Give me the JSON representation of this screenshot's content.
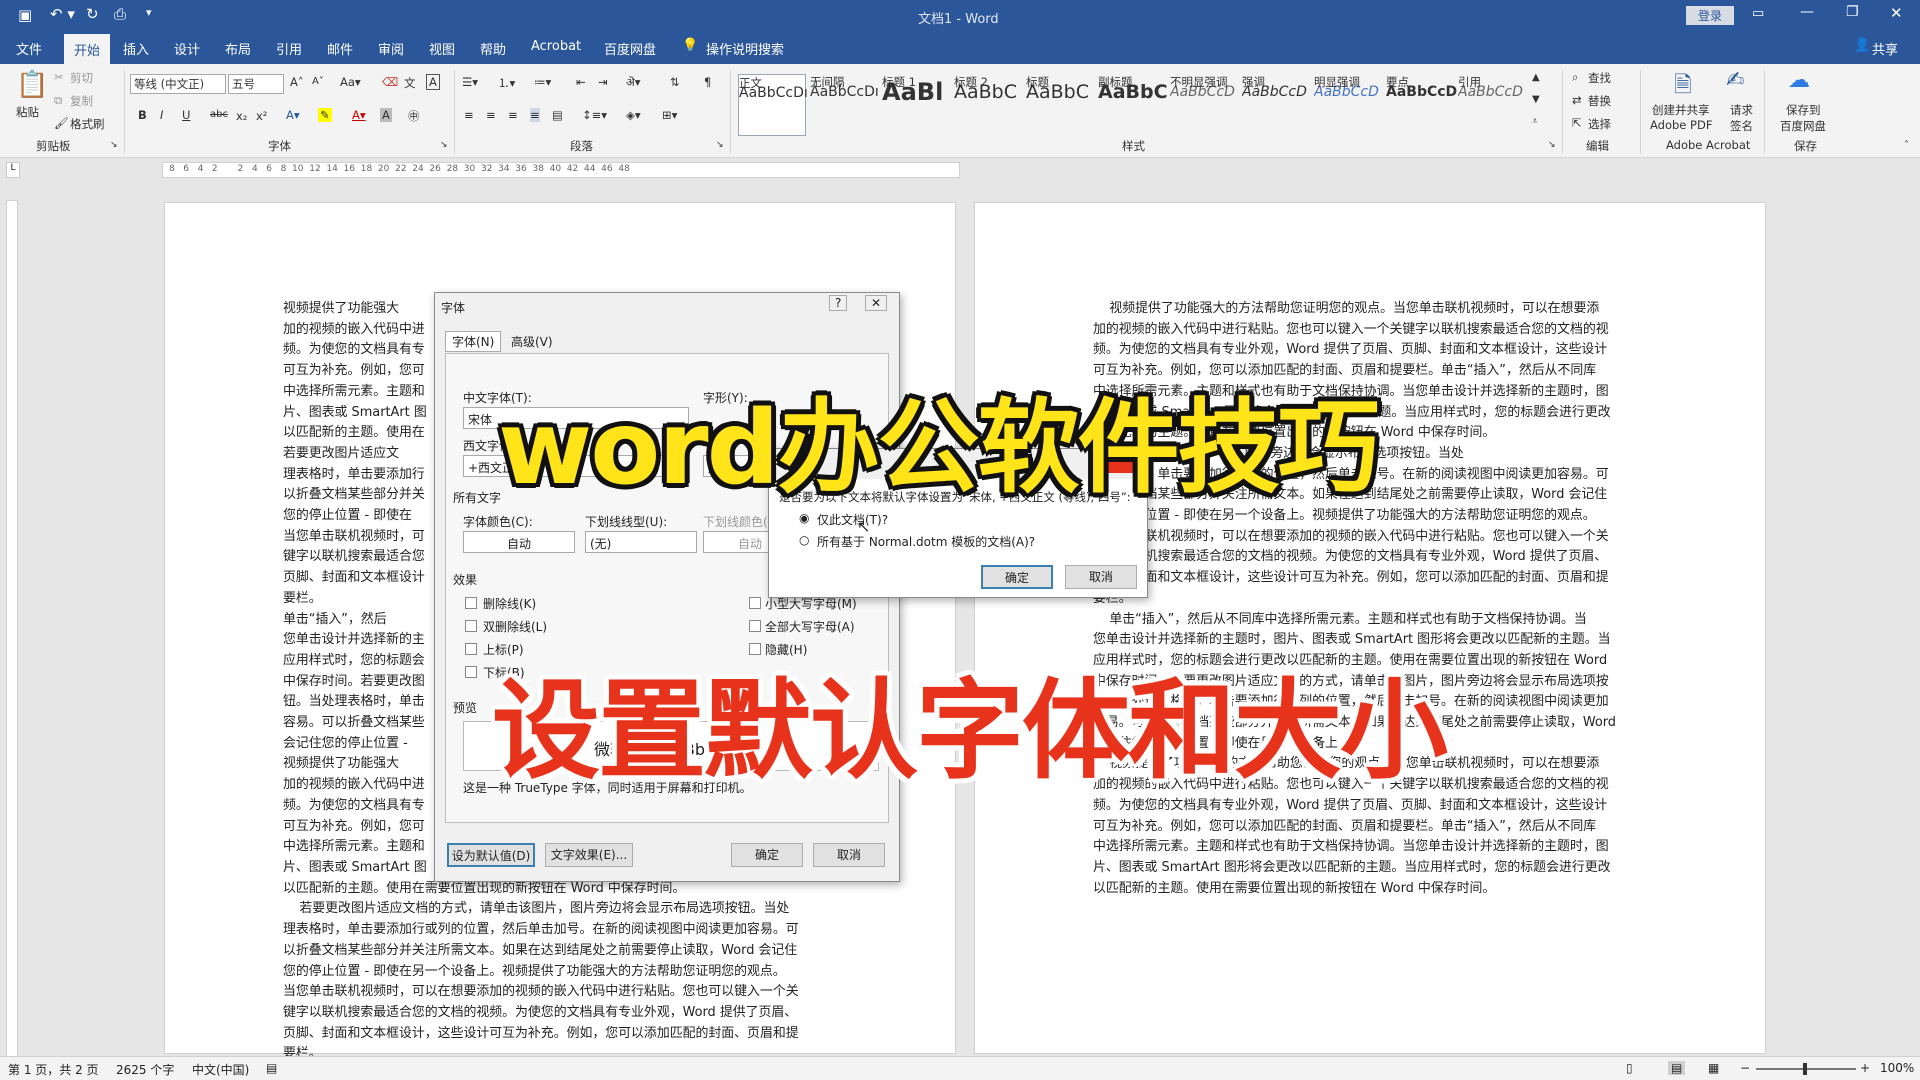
{
  "title": {
    "doc": "文档1",
    "sep": "-",
    "app": "Word",
    "login": "登录"
  },
  "tabs": [
    "文件",
    "开始",
    "插入",
    "设计",
    "布局",
    "引用",
    "邮件",
    "审阅",
    "视图",
    "帮助",
    "Acrobat",
    "百度网盘",
    "操作说明搜索"
  ],
  "share": "共享",
  "clipboard": {
    "paste": "粘贴",
    "cut": "剪切",
    "copy": "复制",
    "painter": "格式刷",
    "group": "剪贴板"
  },
  "font": {
    "name": "等线 (中文正)",
    "size": "五号",
    "group": "字体",
    "bold": "B",
    "italic": "I",
    "underline": "U"
  },
  "paragraph": {
    "group": "段落"
  },
  "styles": {
    "group": "样式",
    "items": [
      {
        "sample": "AaBbCcDı",
        "name": "正文"
      },
      {
        "sample": "AaBbCcDı",
        "name": "无间隔"
      },
      {
        "sample": "AaBl",
        "name": "标题 1"
      },
      {
        "sample": "AaBbC",
        "name": "标题 2"
      },
      {
        "sample": "AaBbC",
        "name": "标题"
      },
      {
        "sample": "AaBbC",
        "name": "副标题"
      },
      {
        "sample": "AaBbCcD",
        "name": "不明显强调"
      },
      {
        "sample": "AaBbCcD",
        "name": "强调"
      },
      {
        "sample": "AaBbCcD",
        "name": "明显强调"
      },
      {
        "sample": "AaBbCcD",
        "name": "要点"
      },
      {
        "sample": "AaBbCcD",
        "name": "引用"
      }
    ]
  },
  "editing": {
    "find": "查找",
    "replace": "替换",
    "select": "选择",
    "group": "编辑"
  },
  "acrobat": {
    "create1": "创建并共享",
    "create2": "Adobe PDF",
    "request1": "请求",
    "request2": "签名",
    "group": "Adobe Acrobat"
  },
  "save": {
    "l1": "保存到",
    "l2": "百度网盘",
    "group": "保存"
  },
  "ruler_numbers": "8   6   4   2       2   4   6   8  10  12  14  16  18  20  22  24  26  28  30  32  34  36  38  40  42  44  46  48",
  "page1_lines": [
    "视频提供了功能强大",
    "加的视频的嵌入代码中进",
    "频。为使您的文档具有专",
    "可互为补充。例如，您可",
    "中选择所需元素。主题和",
    "片、图表或 SmartArt 图",
    "以匹配新的主题。使用在",
    "若要更改图片适应文",
    "理表格时，单击要添加行",
    "以折叠文档某些部分并关",
    "您的停止位置 - 即使在",
    "当您单击联机视频时，可",
    "键字以联机搜索最适合您",
    "页脚、封面和文本框设计",
    "要栏。",
    "单击“插入”，然后",
    "您单击设计并选择新的主",
    "应用样式时，您的标题会",
    "中保存时间。若要更改图",
    "钮。当处理表格时，单击",
    "容易。可以折叠文档某些",
    "会记住您的停止位置 -",
    "视频提供了功能强大",
    "加的视频的嵌入代码中进",
    "频。为使您的文档具有专",
    "可互为补充。例如，您可",
    "中选择所需元素。主题和",
    "片、图表或 SmartArt 图",
    "以匹配新的主题。使用在需要位置出现的新按钮在 Word 中保存时间。",
    "    若要更改图片适应文档的方式，请单击该图片，图片旁边将会显示布局选项按钮。当处",
    "理表格时，单击要添加行或列的位置，然后单击加号。在新的阅读视图中阅读更加容易。可",
    "以折叠文档某些部分并关注所需文本。如果在达到结尾处之前需要停止读取，Word 会记住",
    "您的停止位置 - 即使在另一个设备上。视频提供了功能强大的方法帮助您证明您的观点。",
    "当您单击联机视频时，可以在想要添加的视频的嵌入代码中进行粘贴。您也可以键入一个关",
    "键字以联机搜索最适合您的文档的视频。为使您的文档具有专业外观，Word 提供了页眉、",
    "页脚、封面和文本框设计，这些设计可互为补充。例如，您可以添加匹配的封面、页眉和提",
    "要栏。"
  ],
  "page2_lines": [
    "    视频提供了功能强大的方法帮助您证明您的观点。当您单击联机视频时，可以在想要添",
    "加的视频的嵌入代码中进行粘贴。您也可以键入一个关键字以联机搜索最适合您的文档的视",
    "频。为使您的文档具有专业外观，Word 提供了页眉、页脚、封面和文本框设计，这些设计",
    "可互为补充。例如，您可以添加匹配的封面、页眉和提要栏。单击“插入”，然后从不同库",
    "中选择所需元素。主题和样式也有助于文档保持协调。当您单击设计并选择新的主题时，图",
    "片、图表或 SmartArt 图形将会更改以匹配新的主题。当应用样式时，您的标题会进行更改",
    "以匹配新的主题。使用在需要位置出现的新按钮在 Word 中保存时间。",
    "                                     图片旁边将会显示布局选项按钮。当处",
    "理表格时，单击要添加行或列的位置，然后单击加号。在新的阅读视图中阅读更加容易。可",
    "以折叠文档某些部分并关注所需文本。如果在达到结尾处之前需要停止读取，Word 会记住",
    "您的停止位置 - 即使在另一个设备上。视频提供了功能强大的方法帮助您证明您的观点。",
    "当您单击联机视频时，可以在想要添加的视频的嵌入代码中进行粘贴。您也可以键入一个关",
    "键字以联机搜索最适合您的文档的视频。为使您的文档具有专业外观，Word 提供了页眉、",
    "页脚、封面和文本框设计，这些设计可互为补充。例如，您可以添加匹配的封面、页眉和提",
    "要栏。",
    "    单击“插入”，然后从不同库中选择所需元素。主题和样式也有助于文档保持协调。当",
    "您单击设计并选择新的主题时，图片、图表或 SmartArt 图形将会更改以匹配新的主题。当",
    "应用样式时，您的标题会进行更改以匹配新的主题。使用在需要位置出现的新按钮在 Word",
    "中保存时间。若要更改图片适应文档的方式，请单击该图片，图片旁边将会显示布局选项按",
    "钮。当处理表格时，单击要添加行或列的位置，然后单击加号。在新的阅读视图中阅读更加",
    "容易。可以折叠文档某些部分并关注所需文本。如果在达到结尾处之前需要停止读取，Word",
    "会记住您的停止位置 - 即使在另一个设备上。",
    "    视频提供了功能强大的方法帮助您证明您的观点。当您单击联机视频时，可以在想要添",
    "加的视频的嵌入代码中进行粘贴。您也可以键入一个关键字以联机搜索最适合您的文档的视",
    "频。为使您的文档具有专业外观，Word 提供了页眉、页脚、封面和文本框设计，这些设计",
    "可互为补充。例如，您可以添加匹配的封面、页眉和提要栏。单击“插入”，然后从不同库",
    "中选择所需元素。主题和样式也有助于文档保持协调。当您单击设计并选择新的主题时，图",
    "片、图表或 SmartArt 图形将会更改以匹配新的主题。当应用样式时，您的标题会进行更改",
    "以匹配新的主题。使用在需要位置出现的新按钮在 Word 中保存时间。"
  ],
  "font_dialog": {
    "title": "字体",
    "help": "?",
    "close": "✕",
    "tab_font": "字体(N)",
    "tab_adv": "高级(V)",
    "cn_font_label": "中文字体(T):",
    "cn_font_value": "宋体",
    "style_label": "字形(Y):",
    "west_font_label": "西文字体(F):",
    "west_font_value": "+西文正文",
    "style_value": "加粗",
    "all_text": "所有文字",
    "color_label": "字体颜色(C):",
    "color_value": "自动",
    "underline_label": "下划线线型(U):",
    "underline_value": "(无)",
    "underline_color_label": "下划线颜色(I):",
    "underline_color_value": "自动",
    "effects": "效果",
    "strike": "删除线(K)",
    "dstrike": "双删除线(L)",
    "sup": "上标(P)",
    "sub": "下标(B)",
    "smallcaps": "小型大写字母(M)",
    "allcaps": "全部大写字母(A)",
    "hidden": "隐藏(H)",
    "preview": "预览",
    "preview_text": "微软卓越  AaBbCc",
    "truetype": "这是一种 TrueType 字体，同时适用于屏幕和打印机。",
    "default_btn": "设为默认值(D)",
    "effects_btn": "文字效果(E)...",
    "ok": "确定",
    "cancel": "取消"
  },
  "confirm": {
    "question": "是否要为以下文本将默认字体设置为“宋体, +西文正文 (等线), 四号”:",
    "opt1": "仅此文档(T)?",
    "opt2": "所有基于 Normal.dotm 模板的文档(A)?",
    "ok": "确定",
    "cancel": "取消"
  },
  "overlay": {
    "line1": "word办公软件技巧",
    "line2": "设置默认字体和大小"
  },
  "status": {
    "page": "第 1 页，共 2 页",
    "words": "2625 个字",
    "lang": "中文(中国)",
    "zoom": "100%"
  },
  "colors": {
    "brand": "#2b579a",
    "overlay_yellow": "#ffe41a",
    "overlay_red": "#e8331c"
  }
}
